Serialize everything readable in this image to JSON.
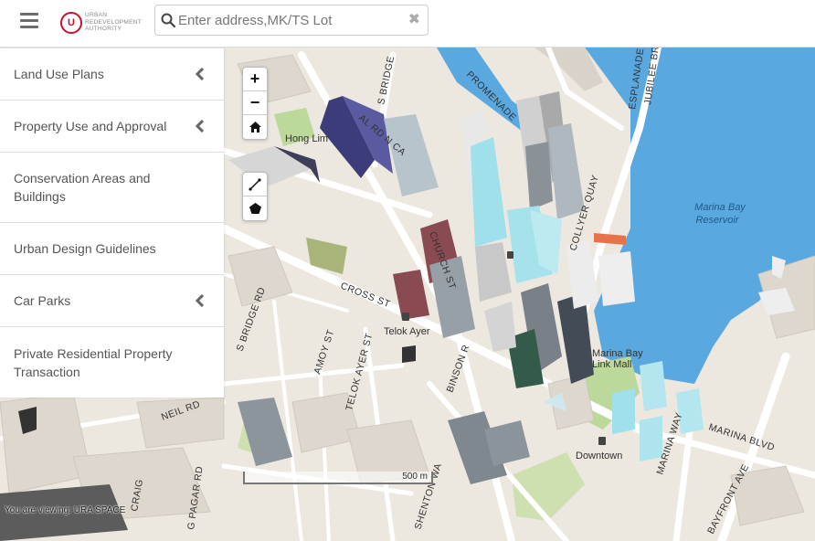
{
  "header": {
    "logo_mark": "U",
    "logo_lines": [
      "URBAN",
      "REDEVELOPMENT",
      "AUTHORITY"
    ],
    "search_placeholder": "Enter address,MK/TS Lot",
    "clear_glyph": "✖"
  },
  "sidebar": {
    "items": [
      {
        "label": "Land Use Plans",
        "expandable": true
      },
      {
        "label": "Property Use and Approval",
        "expandable": true
      },
      {
        "label": "Conservation Areas and Buildings",
        "expandable": false
      },
      {
        "label": "Urban Design Guidelines",
        "expandable": false
      },
      {
        "label": "Car Parks",
        "expandable": true
      },
      {
        "label": "Private Residential Property Transaction",
        "expandable": false
      }
    ]
  },
  "map_controls": {
    "zoom_in": "+",
    "zoom_out": "−",
    "icons": [
      "home-icon",
      "measure-line-icon",
      "measure-polygon-icon"
    ]
  },
  "map": {
    "scale_label": "500 m",
    "viewing_text": "You are viewing: URA SPACE",
    "water_color": "#5aa8e0",
    "land_color": "#ece7df",
    "roads": {
      "promenade": "PROMENADE",
      "esplanade": "ESPLANADE",
      "jubilee_bridge": "JUBILEE BR",
      "s_bridge": "S BRIDGE",
      "s_bridge_rd": "S BRIDGE RD",
      "north_canal_rd": "AL RD N CA",
      "church_st": "CHURCH ST",
      "collyer_quay": "COLLYER QUAY",
      "cross_st": "CROSS ST",
      "binson_rd": "BINSON R",
      "amoy_st": "AMOY ST",
      "telok_ayer_st": "TELOK AYER ST",
      "shenton_way": "SHENTON WA",
      "marina_way": "MARINA WAY",
      "marina_blvd": "MARINA BLVD",
      "bayfront_ave": "BAYFRONT AVE",
      "pagoda_st": "NEIL RD",
      "craig": "CRAIG",
      "pagar": "G PAGAR RD"
    },
    "places": {
      "marina_bay_reservoir": [
        "Marina Bay",
        "Reservoir"
      ],
      "telok_ayer": "Telok Ayer",
      "marina_bay_link_mall": [
        "Marina Bay",
        "Link Mall"
      ],
      "downtown": "Downtown",
      "hong_lim": "Hong Lim"
    }
  }
}
